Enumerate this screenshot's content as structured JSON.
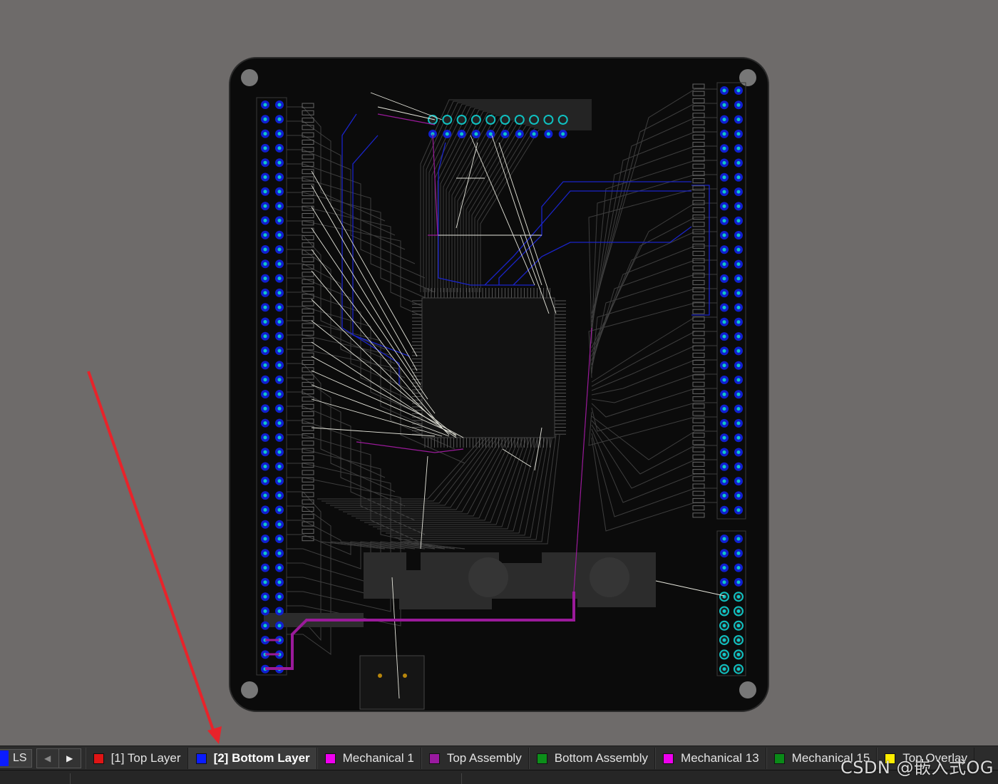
{
  "toolbar": {
    "ls_label": "LS",
    "nav_prev_icon": "chevron-left-icon",
    "nav_next_icon": "chevron-right-icon"
  },
  "layers": [
    {
      "label": "[1] Top Layer",
      "color": "#e01515",
      "active": false
    },
    {
      "label": "[2] Bottom Layer",
      "color": "#0a1cff",
      "active": true
    },
    {
      "label": "Mechanical 1",
      "color": "#ee00ee",
      "active": false
    },
    {
      "label": "Top Assembly",
      "color": "#9a1aa0",
      "active": false
    },
    {
      "label": "Bottom Assembly",
      "color": "#0c8f1a",
      "active": false
    },
    {
      "label": "Mechanical 13",
      "color": "#ee00ee",
      "active": false
    },
    {
      "label": "Mechanical 15",
      "color": "#0a8a18",
      "active": false
    },
    {
      "label": "Top Overlay",
      "color": "#ffee00",
      "active": false
    }
  ],
  "watermark": "CSDN @嵌入式OG",
  "colors": {
    "background": "#6e6b6a",
    "board": "#0a0a0a",
    "bottom_layer": "#1a26d8",
    "pad": "#10c0c0",
    "ratsnest": "#e8e8e8",
    "assembly": "#9b1b9b",
    "annotation_arrow": "#e8232a"
  }
}
